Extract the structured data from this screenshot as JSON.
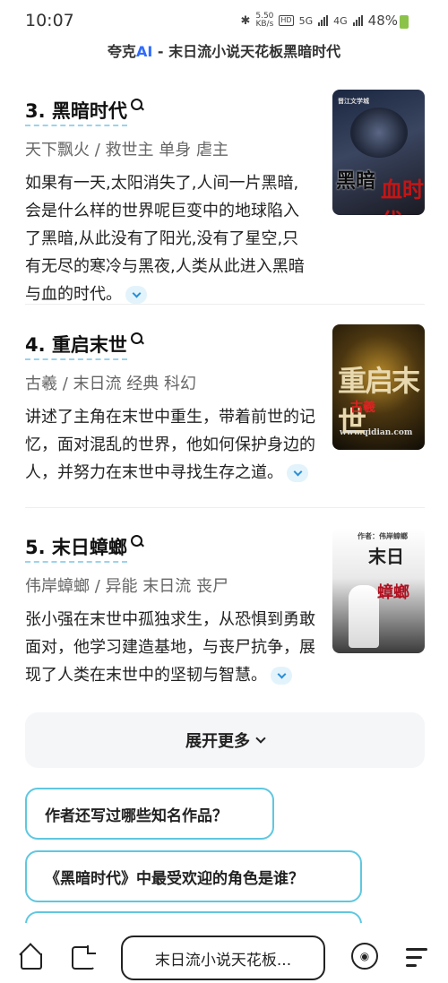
{
  "status": {
    "time": "10:07",
    "speed_value": "5.50",
    "speed_unit": "KB/s",
    "hd": "HD",
    "net1": "5G",
    "net2": "4G",
    "battery": "48%"
  },
  "header": {
    "brand": "夸克",
    "brand_ai": "AI",
    "title_rest": " - 末日流小说天花板黑暗时代"
  },
  "items": [
    {
      "title": "3. 黑暗时代",
      "meta": "天下飘火 / 救世主 单身 虐主",
      "desc": "如果有一天,太阳消失了,人间一片黑暗,会是什么样的世界呢巨变中的地球陷入了黑暗,从此没有了阳光,没有了星空,只有无尽的寒冷与黑夜,人类从此进入黑暗与血的时代。",
      "cover_top": "黑暗",
      "cover_accent": "血时代",
      "cover_small": "晋江文学城"
    },
    {
      "title": "4. 重启末世",
      "meta": "古羲 / 末日流 经典 科幻",
      "desc": "讲述了主角在末世中重生，带着前世的记忆，面对混乱的世界，他如何保护身边的人，并努力在末世中寻找生存之道。",
      "cover_top": "重启末世",
      "cover_accent": "古羲",
      "cover_small": "www.qidian.com"
    },
    {
      "title": "5. 末日蟑螂",
      "meta": "伟岸蟑螂 / 异能 末日流 丧尸",
      "desc": "张小强在末世中孤独求生，从恐惧到勇敢面对，他学习建造基地，与丧尸抗争，展现了人类在末世中的坚韧与智慧。",
      "cover_top": "末日",
      "cover_accent": "蟑螂",
      "cover_small": "作者：伟岸蟑螂"
    }
  ],
  "more_label": "展开更多",
  "questions": [
    "作者还写过哪些知名作品？",
    "《黑暗时代》中最受欢迎的角色是谁？"
  ],
  "bottom": {
    "search_text": "末日流小说天花板...",
    "voice_icon_label": "◉"
  }
}
